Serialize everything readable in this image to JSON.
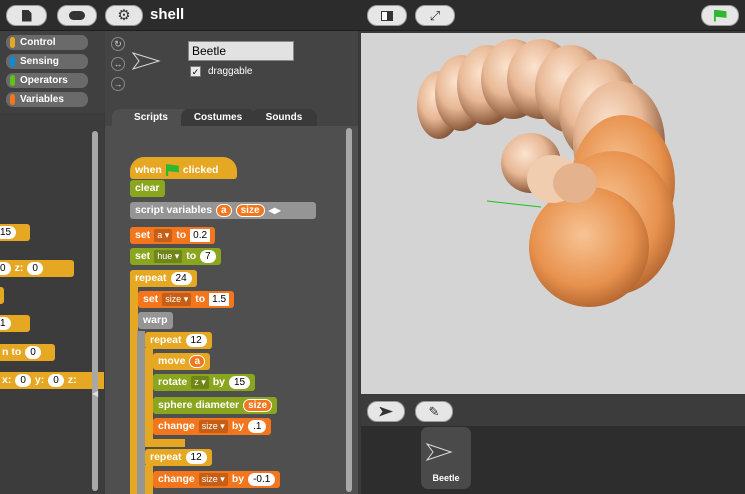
{
  "topbar": {
    "project_name": "shell"
  },
  "categories": [
    {
      "label": "Control",
      "color": "#e6a822"
    },
    {
      "label": "Sensing",
      "color": "#0b8bd8"
    },
    {
      "label": "Operators",
      "color": "#62c213"
    },
    {
      "label": "Variables",
      "color": "#f3761d"
    }
  ],
  "palette_fragments": {
    "v1": "15",
    "z_label": "z:",
    "v2": "0",
    "v3": "0",
    "v4": "1",
    "to_text": "n to",
    "v5": "0",
    "x_label": "x:",
    "v6": "0",
    "y_label": "y:",
    "v7": "0",
    "z2_label": "z:"
  },
  "sprite": {
    "name": "Beetle",
    "draggable_label": "draggable",
    "draggable_checked": "✓"
  },
  "tabs": [
    {
      "label": "Scripts",
      "active": true
    },
    {
      "label": "Costumes",
      "active": false
    },
    {
      "label": "Sounds",
      "active": false
    }
  ],
  "script": {
    "when": "when",
    "clicked": "clicked",
    "clear": "clear",
    "script_vars": "script variables",
    "var_a": "a",
    "var_size": "size",
    "set1": "set",
    "set1_var": "a",
    "set1_to": "to",
    "set1_val": "0.2",
    "set2": "set",
    "set2_var": "hue",
    "set2_to": "to",
    "set2_val": "7",
    "repeat1": "repeat",
    "repeat1_val": "24",
    "set3": "set",
    "set3_var": "size",
    "set3_to": "to",
    "set3_val": "1.5",
    "warp": "warp",
    "repeat2": "repeat",
    "repeat2_val": "12",
    "move": "move",
    "move_val": "a",
    "rotate": "rotate",
    "rotate_axis": "z",
    "rotate_by": "by",
    "rotate_val": "15",
    "sphere": "sphere diameter",
    "sphere_val": "size",
    "change1": "change",
    "change1_var": "size",
    "change1_by": "by",
    "change1_val": ".1",
    "repeat3": "repeat",
    "repeat3_val": "12",
    "change2": "change",
    "change2_var": "size",
    "change2_by": "by",
    "change2_val": "-0.1"
  },
  "corral": {
    "sprite_name": "Beetle"
  },
  "colors": {
    "accent_green": "#2fb82f",
    "shell_color": "#e8b895"
  }
}
